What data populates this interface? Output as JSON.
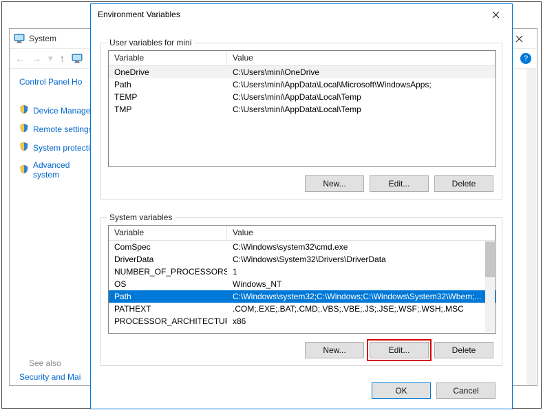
{
  "system_window": {
    "title": "System",
    "control_panel_home": "Control Panel Ho",
    "sidebar_items": [
      "Device Manager",
      "Remote settings",
      "System protectio",
      "Advanced system"
    ],
    "see_also": "See also",
    "security_maintenance": "Security and Mai"
  },
  "env_dialog": {
    "title": "Environment Variables",
    "user_group_label": "User variables for mini",
    "sys_group_label": "System variables",
    "col_variable": "Variable",
    "col_value": "Value",
    "user_vars": [
      {
        "name": "OneDrive",
        "value": "C:\\Users\\mini\\OneDrive"
      },
      {
        "name": "Path",
        "value": "C:\\Users\\mini\\AppData\\Local\\Microsoft\\WindowsApps;"
      },
      {
        "name": "TEMP",
        "value": "C:\\Users\\mini\\AppData\\Local\\Temp"
      },
      {
        "name": "TMP",
        "value": "C:\\Users\\mini\\AppData\\Local\\Temp"
      }
    ],
    "sys_vars": [
      {
        "name": "ComSpec",
        "value": "C:\\Windows\\system32\\cmd.exe"
      },
      {
        "name": "DriverData",
        "value": "C:\\Windows\\System32\\Drivers\\DriverData"
      },
      {
        "name": "NUMBER_OF_PROCESSORS",
        "value": "1"
      },
      {
        "name": "OS",
        "value": "Windows_NT"
      },
      {
        "name": "Path",
        "value": "C:\\Windows\\system32;C:\\Windows;C:\\Windows\\System32\\Wbem;..."
      },
      {
        "name": "PATHEXT",
        "value": ".COM;.EXE;.BAT;.CMD;.VBS;.VBE;.JS;.JSE;.WSF;.WSH;.MSC"
      },
      {
        "name": "PROCESSOR_ARCHITECTURE",
        "value": "x86"
      }
    ],
    "sys_selected_index": 4,
    "buttons": {
      "new": "New...",
      "edit": "Edit...",
      "delete": "Delete",
      "ok": "OK",
      "cancel": "Cancel"
    }
  }
}
